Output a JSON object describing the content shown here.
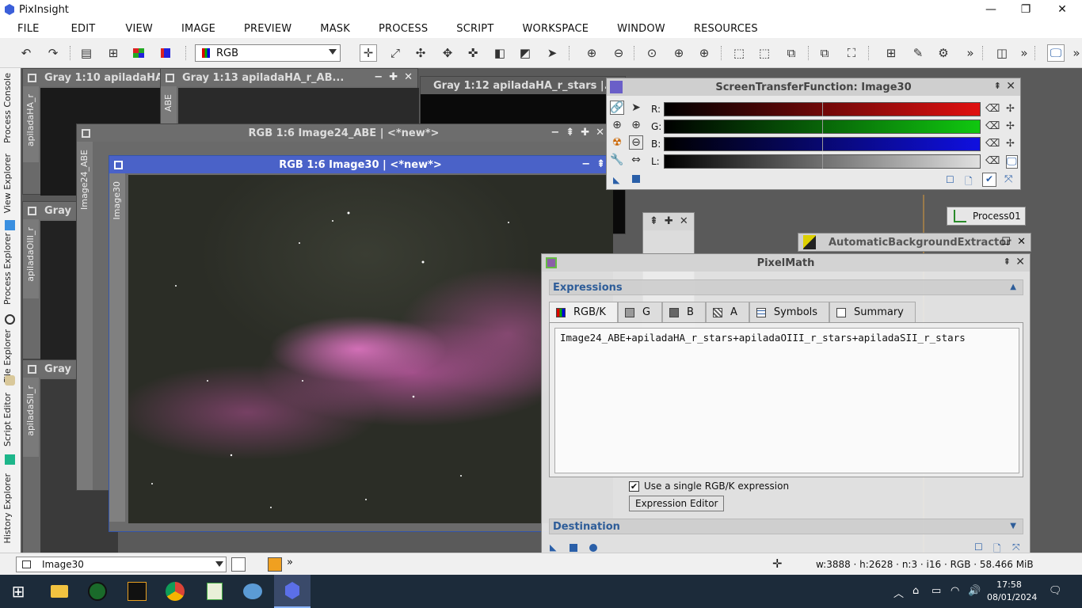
{
  "window": {
    "title": "PixInsight"
  },
  "menu": [
    "FILE",
    "EDIT",
    "VIEW",
    "IMAGE",
    "PREVIEW",
    "MASK",
    "PROCESS",
    "SCRIPT",
    "WORKSPACE",
    "WINDOW",
    "RESOURCES"
  ],
  "toolbar": {
    "color_mode": "RGB"
  },
  "side_tabs": [
    "Process Console",
    "View Explorer",
    "Process Explorer",
    "File Explorer",
    "Script Editor",
    "History Explorer"
  ],
  "image_windows": {
    "w1": {
      "title": "Gray 1:10 apiladaHA",
      "vtab": "apiladaHA_r"
    },
    "w2": {
      "title": "Gray 1:13 apiladaHA_r_AB...",
      "vtab": "ABE"
    },
    "w3": {
      "title": "Gray 1:12 apiladaHA_r_stars |..."
    },
    "w4": {
      "title": "Gray",
      "vtab": "apiladaOIII_r"
    },
    "w5": {
      "title": "Gray",
      "vtab": "apiladaSII_r"
    },
    "w6": {
      "title": "RGB 1:6 Image24_ABE | <*new*>",
      "vtab": "Image24_ABE"
    },
    "main": {
      "title": "RGB 1:6 Image30 | <*new*>",
      "vtab": "Image30"
    }
  },
  "stf": {
    "title": "ScreenTransferFunction: Image30",
    "channels": [
      {
        "label": "R:",
        "color": "#e01010"
      },
      {
        "label": "G:",
        "color": "#10c810"
      },
      {
        "label": "B:",
        "color": "#1010e0"
      },
      {
        "label": "L:",
        "color": "#e0e0e0"
      }
    ]
  },
  "process_icons": {
    "process01": "Process01",
    "abe": "AutomaticBackgroundExtractor"
  },
  "pixelmath": {
    "title": "PixelMath",
    "expressions_header": "Expressions",
    "tabs": [
      "RGB/K",
      "G",
      "B",
      "A",
      "Symbols",
      "Summary"
    ],
    "expression": "Image24_ABE+apiladaHA_r_stars+apiladaOIII_r_stars+apiladaSII_r_stars",
    "single_expr_label": "Use a single RGB/K expression",
    "single_expr_checked": true,
    "expression_editor": "Expression Editor",
    "destination_header": "Destination"
  },
  "statusbar": {
    "view": "Image30",
    "info": "w:3888 · h:2628 · n:3 · i16 · RGB · 58.466 MiB"
  },
  "taskbar": {
    "time": "17:58",
    "date": "08/01/2024"
  }
}
